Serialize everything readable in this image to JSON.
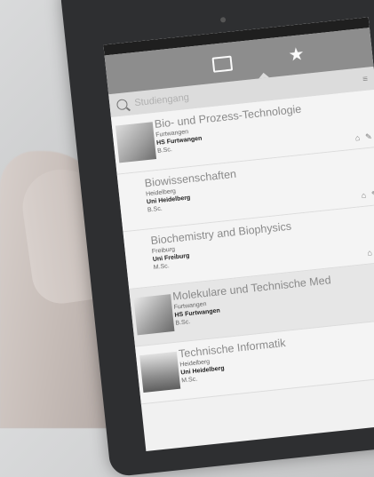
{
  "toolbar": {
    "tabs": [
      {
        "name": "folder-icon",
        "selected": true
      },
      {
        "name": "star-icon",
        "selected": false
      }
    ]
  },
  "search": {
    "placeholder": "Studiengang"
  },
  "items": [
    {
      "title": "Bio- und Prozess-Technologie",
      "city": "Furtwangen",
      "university": "HS Furtwangen",
      "degree": "B.Sc."
    },
    {
      "title": "Biowissenschaften",
      "city": "Heidelberg",
      "university": "Uni Heidelberg",
      "degree": "B.Sc."
    },
    {
      "title": "Biochemistry and Biophysics",
      "city": "Freiburg",
      "university": "Uni Freiburg",
      "degree": "M.Sc."
    },
    {
      "title": "Molekulare und Technische Med",
      "city": "Furtwangen",
      "university": "HS Furtwangen",
      "degree": "B.Sc."
    },
    {
      "title": "Technische Informatik",
      "city": "Heidelberg",
      "university": "Uni Heidelberg",
      "degree": "M.Sc."
    }
  ]
}
